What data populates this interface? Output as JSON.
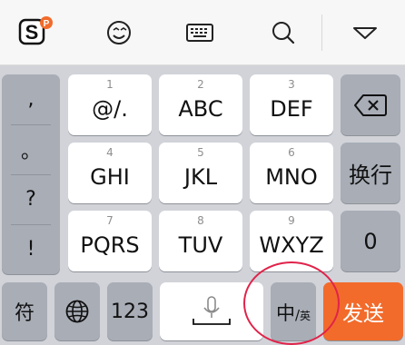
{
  "toolbar": {
    "items": [
      {
        "name": "sogou-logo-icon"
      },
      {
        "name": "emoji-icon"
      },
      {
        "name": "keyboard-icon"
      },
      {
        "name": "search-icon"
      },
      {
        "name": "collapse-icon"
      }
    ]
  },
  "punctuation": [
    ",",
    "。",
    "?",
    "!"
  ],
  "keys": {
    "k1": {
      "num": "1",
      "label": "@/."
    },
    "k2": {
      "num": "2",
      "label": "ABC"
    },
    "k3": {
      "num": "3",
      "label": "DEF"
    },
    "k4": {
      "num": "4",
      "label": "GHI"
    },
    "k5": {
      "num": "5",
      "label": "JKL"
    },
    "k6": {
      "num": "6",
      "label": "MNO"
    },
    "k7": {
      "num": "7",
      "label": "PQRS"
    },
    "k8": {
      "num": "8",
      "label": "TUV"
    },
    "k9": {
      "num": "9",
      "label": "WXYZ"
    },
    "k0": {
      "label": "0"
    },
    "newline": {
      "label": "换行"
    }
  },
  "bottom_row": {
    "symbol_label": "符",
    "numbers_label": "123",
    "lang_main": "中",
    "lang_sep": "/",
    "lang_sub": "英",
    "send_label": "发送"
  },
  "colors": {
    "send_key": "#f26b2b",
    "annotation_circle": "#e0234a"
  }
}
